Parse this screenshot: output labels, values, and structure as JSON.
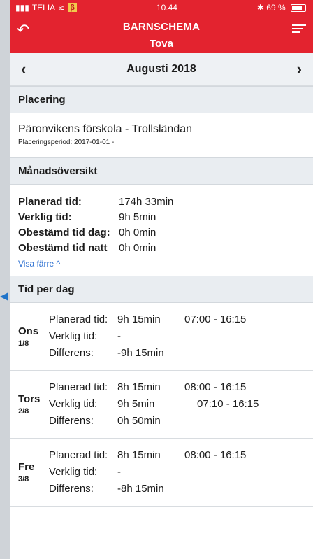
{
  "status": {
    "carrier": "TELIA",
    "carrier_badge": "β",
    "time": "10.44",
    "battery": "69 %"
  },
  "nav": {
    "title": "BARNSCHEMA",
    "subtitle": "Tova"
  },
  "month": {
    "label": "Augusti 2018"
  },
  "placement": {
    "header": "Placering",
    "name": "Päronvikens förskola - Trollsländan",
    "period": "Placeringsperiod: 2017-01-01 -"
  },
  "overview": {
    "header": "Månadsöversikt",
    "rows": [
      {
        "label": "Planerad tid:",
        "value": "174h 33min"
      },
      {
        "label": "Verklig tid:",
        "value": "9h 5min"
      },
      {
        "label": "Obestämd tid dag:",
        "value": "0h 0min"
      },
      {
        "label": "Obestämd tid natt",
        "value": "0h 0min"
      }
    ],
    "toggle": "Visa färre ^"
  },
  "perday": {
    "header": "Tid per dag",
    "days": [
      {
        "day": "Ons",
        "date": "1/8",
        "lines": [
          {
            "k": "Planerad tid:",
            "v": "9h 15min",
            "t": "07:00 - 16:15"
          },
          {
            "k": "Verklig tid:",
            "v": "-",
            "t": ""
          },
          {
            "k": "Differens:",
            "v": "-9h 15min",
            "t": ""
          }
        ]
      },
      {
        "day": "Tors",
        "date": "2/8",
        "lines": [
          {
            "k": "Planerad tid:",
            "v": "8h 15min",
            "t": "08:00 - 16:15"
          },
          {
            "k": "Verklig tid:",
            "v": "9h 5min",
            "t": "07:10 - 16:15"
          },
          {
            "k": "Differens:",
            "v": "0h 50min",
            "t": ""
          }
        ]
      },
      {
        "day": "Fre",
        "date": "3/8",
        "lines": [
          {
            "k": "Planerad tid:",
            "v": "8h 15min",
            "t": "08:00 - 16:15"
          },
          {
            "k": "Verklig tid:",
            "v": "-",
            "t": ""
          },
          {
            "k": "Differens:",
            "v": "-8h 15min",
            "t": ""
          }
        ]
      }
    ]
  },
  "colors": {
    "brand": "#e3232f",
    "link": "#2b6fd1",
    "annotation": "#1f73c9"
  },
  "icons": {
    "back": "back-arrow-icon",
    "menu": "menu-icon",
    "prev": "chevron-left-icon",
    "next": "chevron-right-icon"
  }
}
